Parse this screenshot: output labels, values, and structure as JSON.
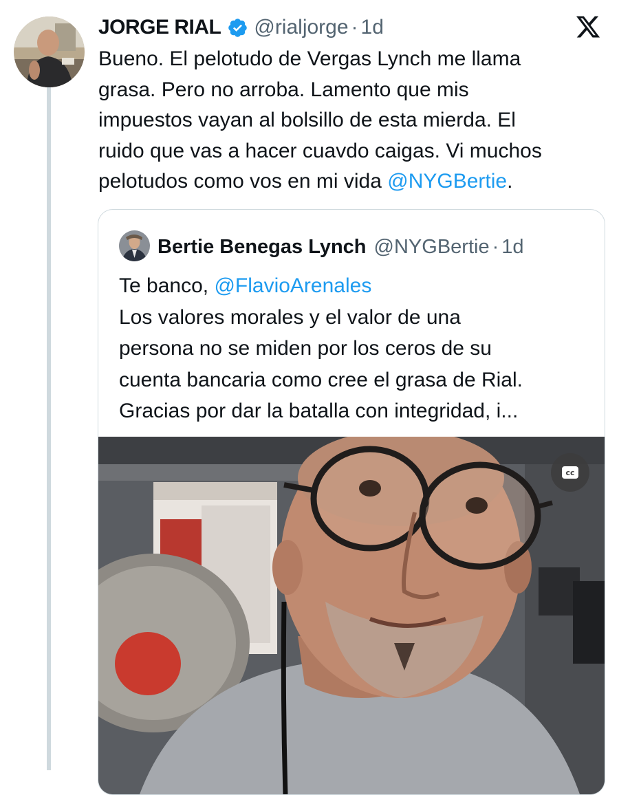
{
  "tweet": {
    "author_name": "JORGE RIAL",
    "handle": "@rialjorge",
    "separator": "·",
    "time": "1d",
    "text_lines": [
      "Bueno. El pelotudo de Vergas Lynch me llama",
      "grasa. Pero no arroba. Lamento que mis",
      "impuestos vayan al bolsillo de esta mierda. El",
      "ruido que vas a hacer cuavdo caigas. Vi muchos",
      "pelotudos como vos en mi vida "
    ],
    "mention": "@NYGBertie",
    "end_punct": "."
  },
  "quote": {
    "author_name": "Bertie Benegas Lynch",
    "handle": "@NYGBertie",
    "separator": "·",
    "time": "1d",
    "line1_prefix": "Te banco, ",
    "mention": "@FlavioArenales",
    "text_lines": [
      "Los valores morales y el valor de una",
      "persona no se miden por los ceros de su",
      "cuenta bancaria como cree el grasa de Rial.",
      "Gracias por dar la batalla con integridad, i..."
    ],
    "cc_label": "cc"
  },
  "colors": {
    "link": "#1d9bf0",
    "muted_text": "#536471",
    "verified_badge": "#1d9bf0",
    "thread_line": "#cfd9de"
  },
  "icons": {
    "verified": "verified-badge-icon",
    "x_logo": "x-logo-icon",
    "captions": "closed-captions-icon"
  }
}
